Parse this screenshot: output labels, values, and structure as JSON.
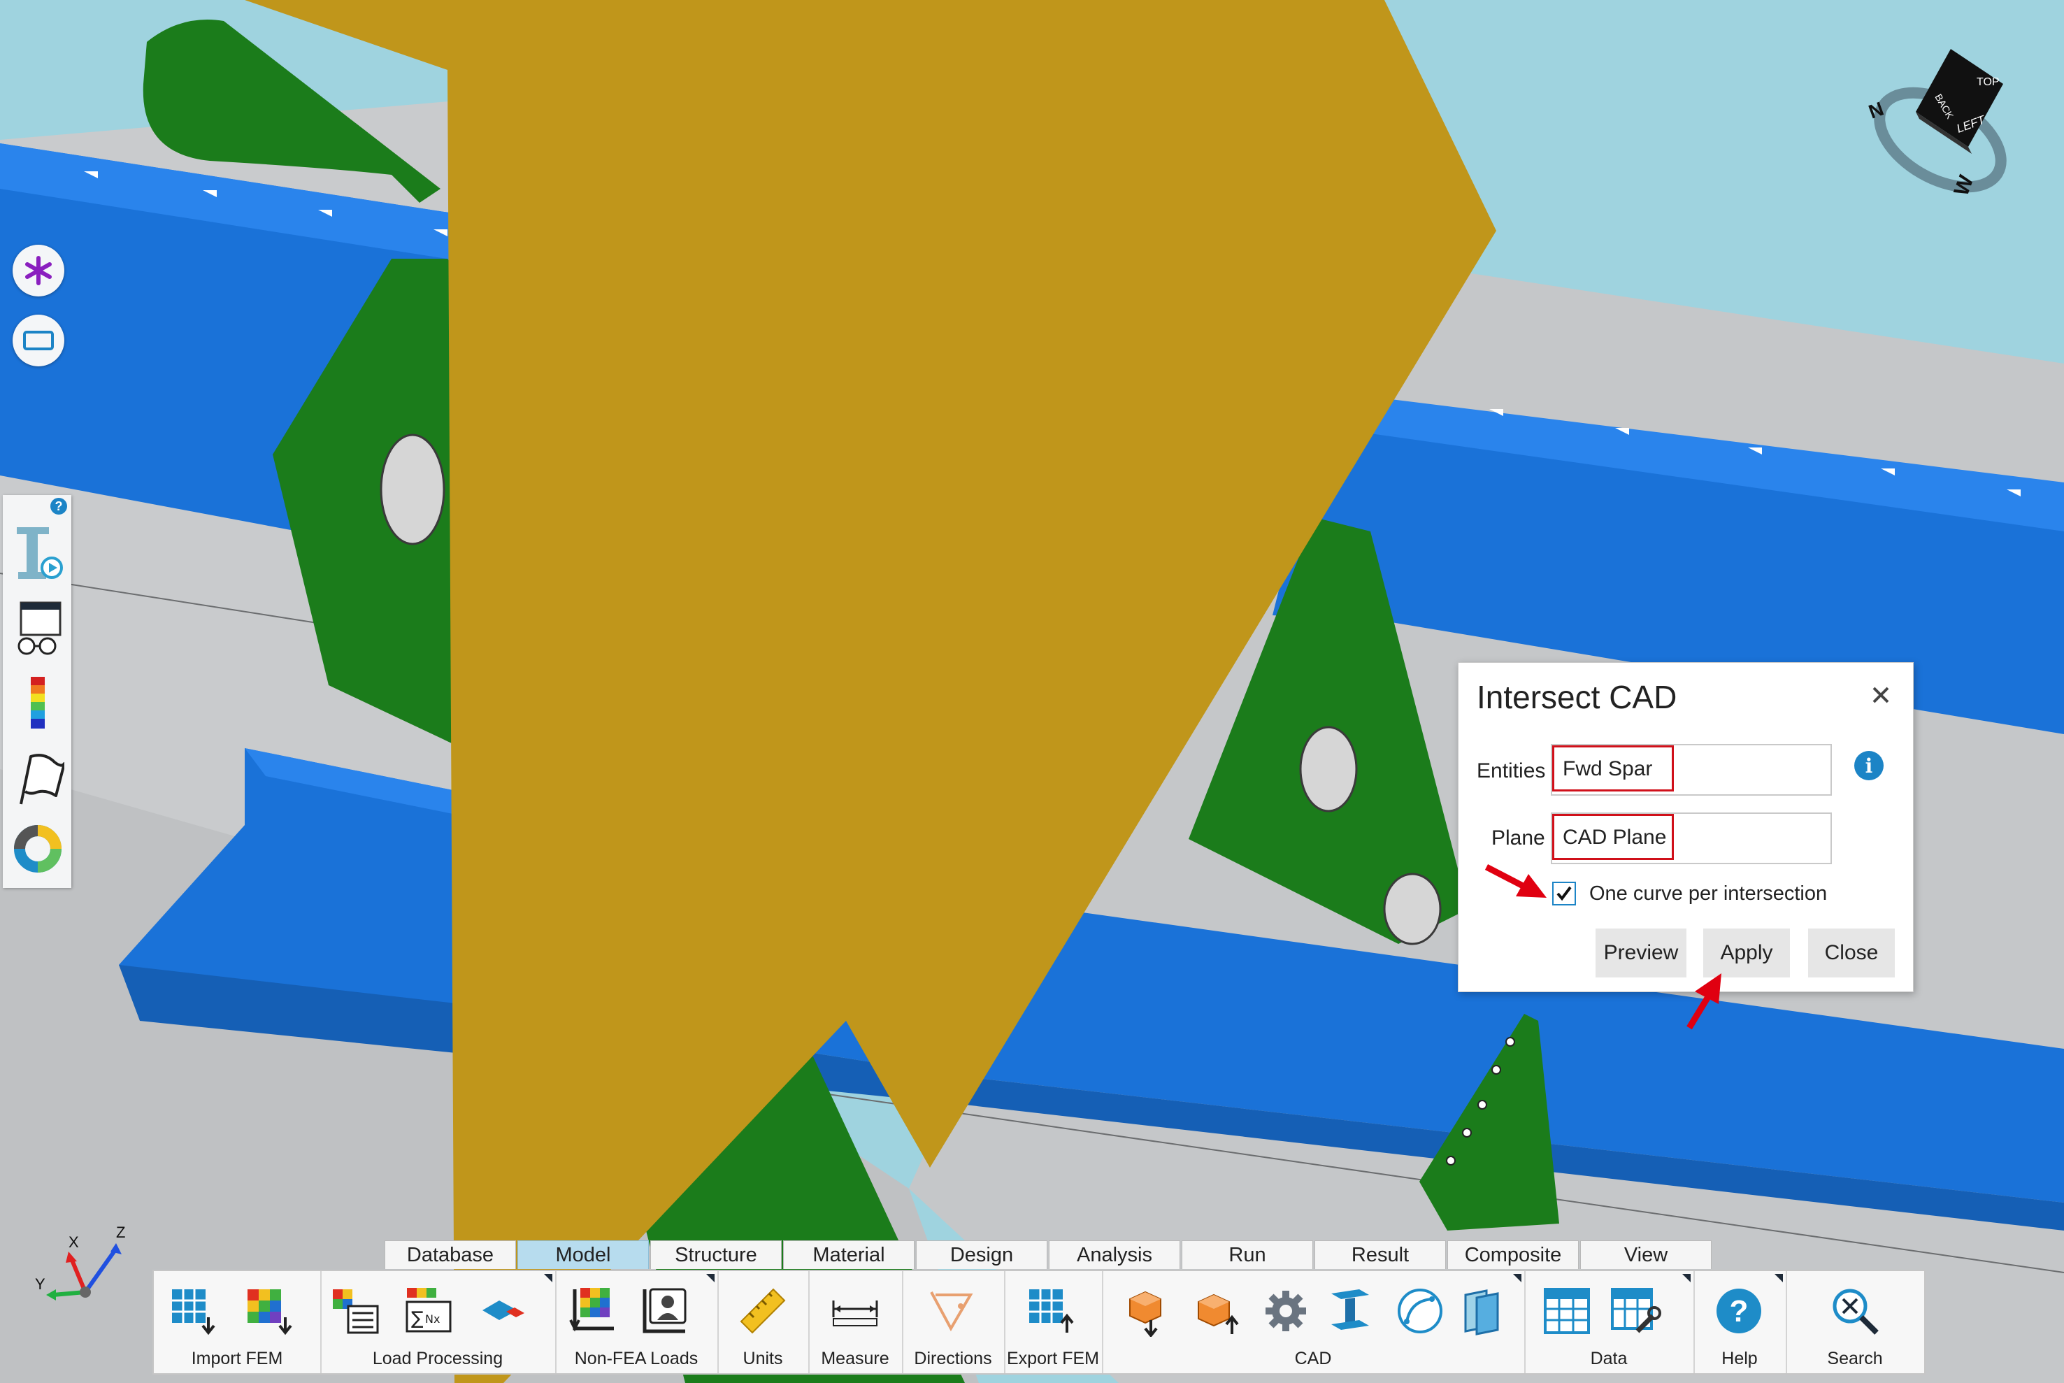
{
  "scene": {
    "colors": {
      "sky": "#9fd3df",
      "gray_skin": "#c7c9cb",
      "blue_stiffener": "#1a72d8",
      "green_rib": "#1b7c1b",
      "cad_plane": "#c0961b"
    }
  },
  "navcube": {
    "faces": [
      "TOP",
      "BACK",
      "LEFT"
    ],
    "compass": [
      "N",
      "W"
    ]
  },
  "triad": {
    "axes": [
      "X",
      "Y",
      "Z"
    ]
  },
  "left_tools": {
    "buttons": [
      "asterisk-icon",
      "rectangle-select-icon"
    ],
    "panel_help": "?",
    "panel_items": [
      "display-style-icon",
      "view-glasses-icon",
      "color-legend-icon",
      "flag-icon",
      "donut-chart-icon"
    ]
  },
  "dialog": {
    "title": "Intersect CAD",
    "entities_label": "Entities",
    "entities_value": "Fwd Spar",
    "plane_label": "Plane",
    "plane_value": "CAD Plane",
    "checkbox_label": "One curve per intersection",
    "checkbox_checked": true,
    "buttons": {
      "preview": "Preview",
      "apply": "Apply",
      "close": "Close"
    },
    "highlight_color": "#d0101a",
    "info_color": "#1c84c6"
  },
  "ribbon": {
    "tabs": [
      "Database",
      "Model",
      "Structure",
      "Material",
      "Design",
      "Analysis",
      "Run",
      "Result",
      "Composite",
      "View"
    ],
    "active_tab": "Model",
    "groups": [
      {
        "label": "Import FEM"
      },
      {
        "label": "Load Processing"
      },
      {
        "label": "Non-FEA Loads"
      },
      {
        "label": "Units"
      },
      {
        "label": "Measure"
      },
      {
        "label": "Directions"
      },
      {
        "label": "Export FEM"
      },
      {
        "label": "CAD"
      },
      {
        "label": "Data"
      },
      {
        "label": "Help"
      },
      {
        "label": "Search"
      }
    ]
  }
}
